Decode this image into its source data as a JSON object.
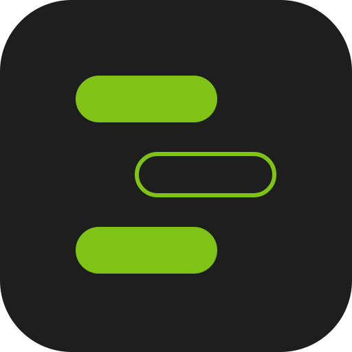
{
  "app_icon": {
    "icon_name": "timeline-bars-icon",
    "colors": {
      "background": "#1e1e1e",
      "accent": "#7ec316"
    },
    "bars": [
      {
        "name": "bar-top",
        "style": "filled"
      },
      {
        "name": "bar-middle",
        "style": "outlined"
      },
      {
        "name": "bar-bottom",
        "style": "filled"
      }
    ]
  }
}
